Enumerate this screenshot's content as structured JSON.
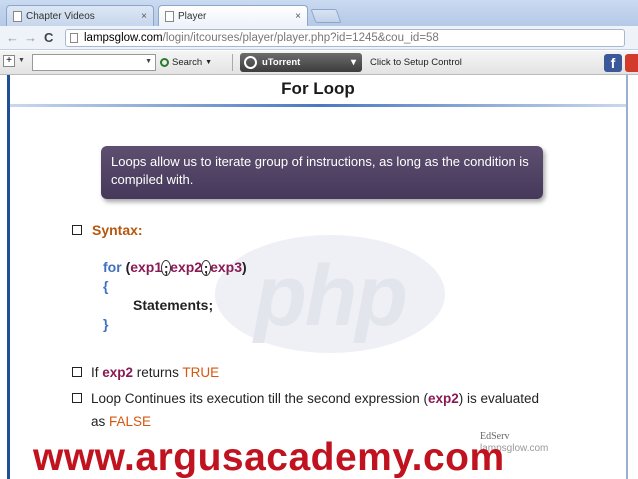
{
  "browser": {
    "tabs": [
      {
        "label": "Chapter Videos",
        "close": "×"
      },
      {
        "label": "Player",
        "close": "×"
      }
    ],
    "nav": {
      "back": "←",
      "forward": "→",
      "reload": "C"
    },
    "url": {
      "host": "lampsglow.com",
      "path": "/login/itcourses/player/player.php?id=1245&cou_id=58"
    }
  },
  "toolbar": {
    "plus": "+",
    "search_button": "Search",
    "utorrent_label": "uTorrent",
    "setup_link": "Click to Setup Control",
    "facebook_letter": "f"
  },
  "slide": {
    "title": "For Loop",
    "callout": "Loops allow us to iterate group of instructions, as long as the condition is compiled with.",
    "syntax_label": "Syntax:",
    "code": {
      "keyword": "for",
      "open_paren": "(",
      "exp1": "exp1",
      "semi": ";",
      "exp2": "exp2",
      "exp3": "exp3",
      "close_paren": ")",
      "open_brace": "{",
      "statements": "Statements;",
      "close_brace": "}"
    },
    "bullet1": {
      "pre": "If ",
      "exp": "exp2",
      "mid": " returns ",
      "value": "TRUE"
    },
    "bullet2": {
      "pre": "Loop Continues its execution till the second expression (",
      "exp": "exp2",
      "post": ") is evaluated",
      "line2_pre": "as ",
      "value": "FALSE"
    },
    "watermark": "php",
    "logo": "EdServ",
    "logo_sub": "lampsglow.com"
  },
  "banner": "www.argusacademy.com",
  "colors": {
    "accent_blue": "#1f4f96",
    "callout_purple": "#4f4163",
    "keyword_blue": "#4070c0",
    "expr_maroon": "#8a1a55",
    "orange": "#d4570f",
    "banner_red": "#c0121f"
  }
}
